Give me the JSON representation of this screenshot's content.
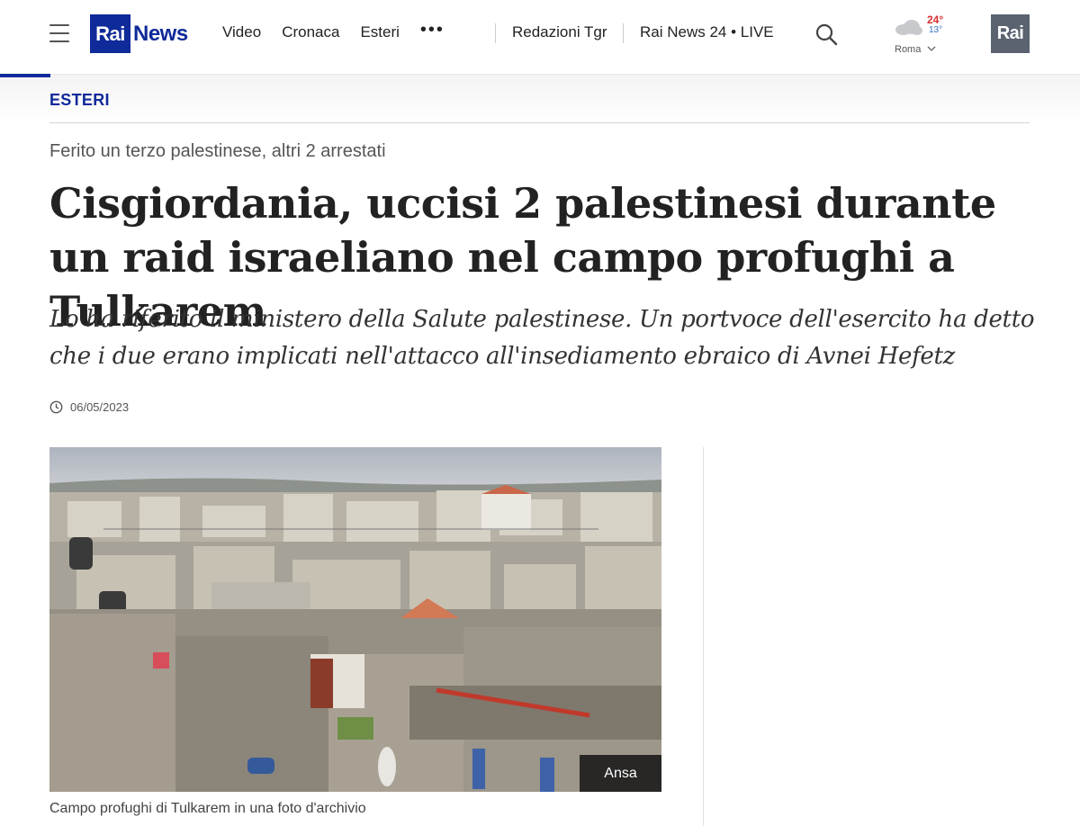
{
  "header": {
    "logo_rai": "Rai",
    "logo_news": "News",
    "nav": [
      "Video",
      "Cronaca",
      "Esteri"
    ],
    "more": "•••",
    "redazioni": "Redazioni Tgr",
    "live": "Rai News 24 • LIVE",
    "weather": {
      "max": "24°",
      "min": "13°",
      "city": "Roma",
      "icon": "cloud-icon"
    },
    "rai_logo": "Rai",
    "colors": {
      "brand": "#0f2a99",
      "max_temp": "#d62d2d",
      "min_temp": "#3670c9"
    }
  },
  "article": {
    "section": "ESTERI",
    "kicker": "Ferito un terzo palestinese, altri 2 arrestati",
    "title": "Cisgiordania, uccisi 2 palestinesi durante un raid israeliano nel campo profughi a Tulkarem",
    "summary": "Lo ha riferito il ministero della Salute palestinese. Un portvoce dell'esercito ha detto che i due erano implicati nell'attacco all'insediamento ebraico di Avnei Hefetz",
    "date": "06/05/2023",
    "image_credit": "Ansa",
    "image_caption": "Campo profughi di Tulkarem in una foto d'archivio"
  }
}
